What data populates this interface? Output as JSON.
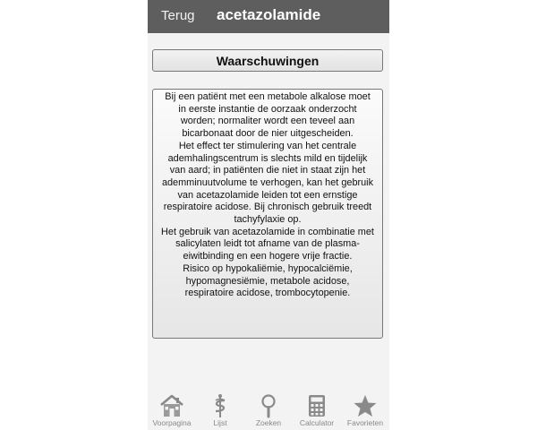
{
  "navbar": {
    "back_label": "Terug",
    "title": "acetazolamide"
  },
  "section": {
    "header": "Waarschuwingen",
    "paragraphs": [
      "Bij een patiënt met een metabole alkalose moet in eerste instantie de oorzaak onderzocht worden; normaliter wordt een teveel aan bicarbonaat door de nier uitgescheiden.",
      "Het effect ter stimulering van het centrale ademhalingscentrum is slechts mild en tijdelijk van aard; in patiënten die niet in staat zijn het ademminuutvolume te verhogen, kan het gebruik van acetazolamide leiden tot een ernstige respiratoire acidose. Bij chronisch gebruik treedt tachyfylaxie op.",
      "Het gebruik van acetazolamide in combinatie met salicylaten leidt tot afname van de plasma-eiwitbinding en een hogere vrije fractie.",
      "Risico op hypokaliëmie, hypocalciëmie, hypomagnesiëmie, metabole acidose, respiratoire acidose, trombocytopenie."
    ]
  },
  "tabbar": {
    "tabs": [
      {
        "label": "Voorpagina",
        "icon": "home-icon"
      },
      {
        "label": "Lijst",
        "icon": "caduceus-icon"
      },
      {
        "label": "Zoeken",
        "icon": "magnifier-icon"
      },
      {
        "label": "Calculator",
        "icon": "calculator-icon"
      },
      {
        "label": "Favorieten",
        "icon": "star-icon"
      }
    ]
  },
  "colors": {
    "navbar_bg": "#5e5e5e",
    "tab_inactive": "#888888"
  }
}
